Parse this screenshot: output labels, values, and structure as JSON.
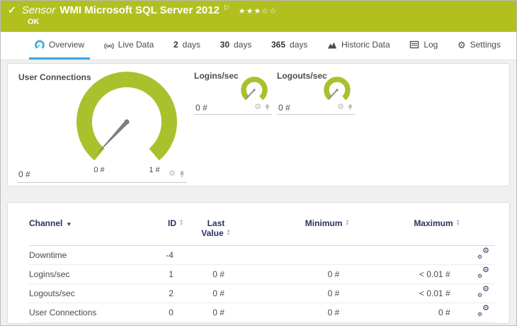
{
  "icons": {
    "check": "✓",
    "flag": "⚐",
    "stars": "★★★☆☆",
    "gear": "⚙",
    "sort_up": "▲",
    "sort_down": "▼",
    "sort_active": "▼"
  },
  "colors": {
    "header_green": "#b1c01e",
    "gauge_green": "#a8c12d",
    "accent_blue": "#36a9e0",
    "table_header_navy": "#27345f"
  },
  "header": {
    "kind": "Sensor",
    "title": "WMI Microsoft SQL Server 2012",
    "status": "OK"
  },
  "tabs": {
    "overview": "Overview",
    "live_data": "Live Data",
    "d2_num": "2",
    "d2_unit": "days",
    "d30_num": "30",
    "d30_unit": "days",
    "d365_num": "365",
    "d365_unit": "days",
    "historic": "Historic Data",
    "log": "Log",
    "settings": "Settings"
  },
  "gauges": {
    "user_connections": {
      "title": "User Connections",
      "value": "0 #",
      "scale_min": "0 #",
      "scale_max": "1 #",
      "numeric_value": 0,
      "numeric_min": 0,
      "numeric_max": 1
    },
    "logins": {
      "title": "Logins/sec",
      "value": "0 #",
      "numeric_value": 0
    },
    "logouts": {
      "title": "Logouts/sec",
      "value": "0 #",
      "numeric_value": 0
    }
  },
  "table": {
    "headers": {
      "channel": "Channel",
      "id": "ID",
      "last_value": "Last Value",
      "minimum": "Minimum",
      "maximum": "Maximum"
    },
    "rows": [
      {
        "channel": "Downtime",
        "id": "-4",
        "last": "",
        "min": "",
        "max": ""
      },
      {
        "channel": "Logins/sec",
        "id": "1",
        "last": "0 #",
        "min": "0 #",
        "max": "< 0.01 #"
      },
      {
        "channel": "Logouts/sec",
        "id": "2",
        "last": "0 #",
        "min": "0 #",
        "max": "< 0.01 #"
      },
      {
        "channel": "User Connections",
        "id": "0",
        "last": "0 #",
        "min": "0 #",
        "max": "0 #"
      }
    ]
  }
}
